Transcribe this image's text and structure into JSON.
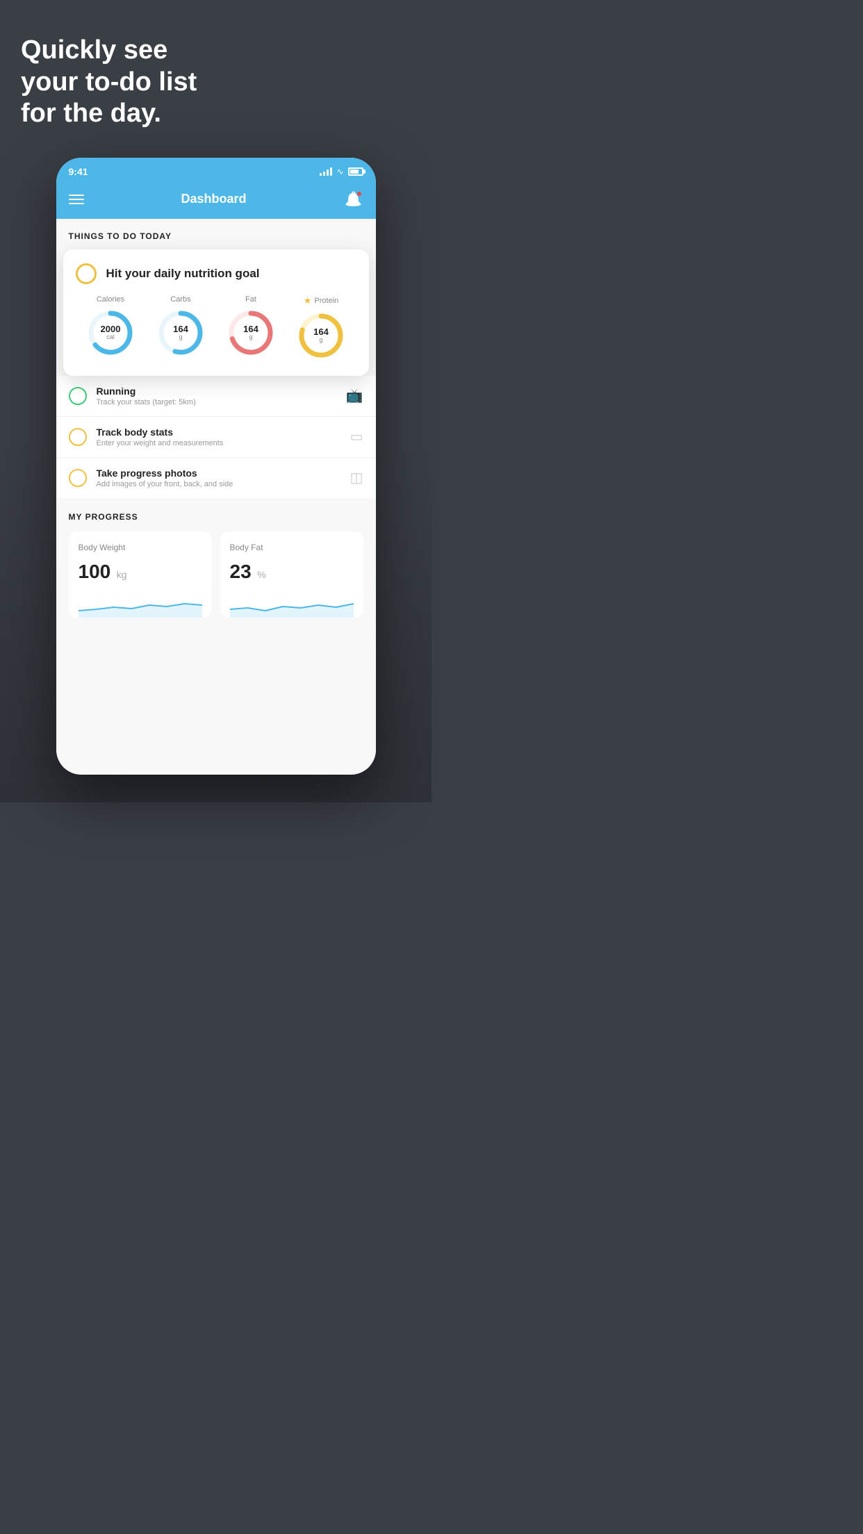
{
  "headline": "Quickly see\nyour to-do list\nfor the day.",
  "phone": {
    "status_time": "9:41",
    "nav_title": "Dashboard",
    "section_things_to_do": "THINGS TO DO TODAY",
    "nutrition_card": {
      "title": "Hit your daily nutrition goal",
      "stats": [
        {
          "label": "Calories",
          "value": "2000",
          "unit": "cal",
          "color": "#4db8e8",
          "track_pct": 65
        },
        {
          "label": "Carbs",
          "value": "164",
          "unit": "g",
          "color": "#4db8e8",
          "track_pct": 55
        },
        {
          "label": "Fat",
          "value": "164",
          "unit": "g",
          "color": "#e87878",
          "track_pct": 70
        },
        {
          "label": "Protein",
          "value": "164",
          "unit": "g",
          "color": "#f0c040",
          "track_pct": 80,
          "star": true
        }
      ]
    },
    "todo_items": [
      {
        "name": "Running",
        "desc": "Track your stats (target: 5km)",
        "circle_color": "green",
        "icon": "👟"
      },
      {
        "name": "Track body stats",
        "desc": "Enter your weight and measurements",
        "circle_color": "yellow",
        "icon": "⚖️"
      },
      {
        "name": "Take progress photos",
        "desc": "Add images of your front, back, and side",
        "circle_color": "yellow",
        "icon": "👤"
      }
    ],
    "progress_section_title": "MY PROGRESS",
    "progress_cards": [
      {
        "title": "Body Weight",
        "value": "100",
        "unit": "kg"
      },
      {
        "title": "Body Fat",
        "value": "23",
        "unit": "%"
      }
    ]
  }
}
